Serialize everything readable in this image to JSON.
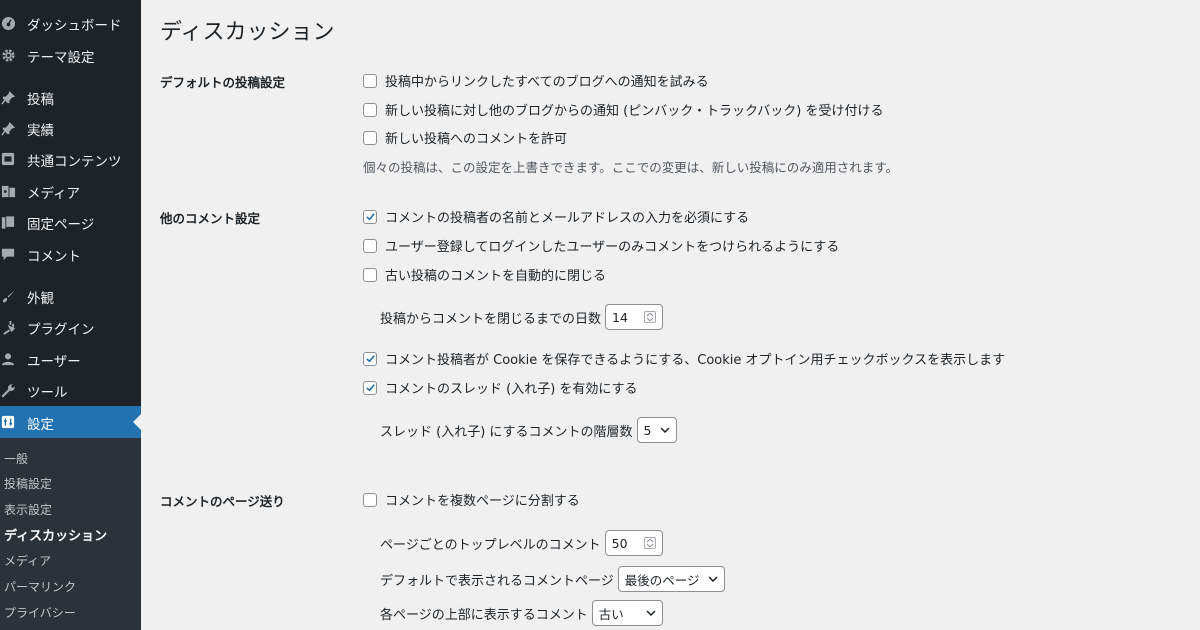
{
  "sidebar": {
    "menu": [
      {
        "label": "ダッシュボード",
        "icon": "dashboard-icon"
      },
      {
        "label": "テーマ設定",
        "icon": "gear-icon"
      },
      {
        "label": "投稿",
        "icon": "pin-icon"
      },
      {
        "label": "実績",
        "icon": "pin-icon"
      },
      {
        "label": "共通コンテンツ",
        "icon": "content-icon"
      },
      {
        "label": "メディア",
        "icon": "media-icon"
      },
      {
        "label": "固定ページ",
        "icon": "page-icon"
      },
      {
        "label": "コメント",
        "icon": "comment-icon"
      },
      {
        "label": "外観",
        "icon": "brush-icon"
      },
      {
        "label": "プラグイン",
        "icon": "plugin-icon"
      },
      {
        "label": "ユーザー",
        "icon": "user-icon"
      },
      {
        "label": "ツール",
        "icon": "wrench-icon"
      },
      {
        "label": "設定",
        "icon": "settings-icon"
      }
    ],
    "submenu": [
      "一般",
      "投稿設定",
      "表示設定",
      "ディスカッション",
      "メディア",
      "パーマリンク",
      "プライバシー"
    ],
    "active_submenu": "ディスカッション"
  },
  "main": {
    "title": "ディスカッション",
    "default_post_settings": {
      "heading": "デフォルトの投稿設定",
      "options": [
        {
          "label": "投稿中からリンクしたすべてのブログへの通知を試みる",
          "checked": false
        },
        {
          "label": "新しい投稿に対し他のブログからの通知 (ピンバック・トラックバック) を受け付ける",
          "checked": false
        },
        {
          "label": "新しい投稿へのコメントを許可",
          "checked": false
        }
      ],
      "description": "個々の投稿は、この設定を上書きできます。ここでの変更は、新しい投稿にのみ適用されます。"
    },
    "other_comment_settings": {
      "heading": "他のコメント設定",
      "options": [
        {
          "label": "コメントの投稿者の名前とメールアドレスの入力を必須にする",
          "checked": true
        },
        {
          "label": "ユーザー登録してログインしたユーザーのみコメントをつけられるようにする",
          "checked": false
        },
        {
          "label": "古い投稿のコメントを自動的に閉じる",
          "checked": false
        }
      ],
      "close_days_label": "投稿からコメントを閉じるまでの日数",
      "close_days_value": "14",
      "options2": [
        {
          "label": "コメント投稿者が Cookie を保存できるようにする、Cookie オプトイン用チェックボックスを表示します",
          "checked": true
        },
        {
          "label": "コメントのスレッド (入れ子) を有効にする",
          "checked": true
        }
      ],
      "thread_depth_label": "スレッド (入れ子) にするコメントの階層数",
      "thread_depth_value": "5"
    },
    "comment_pagination": {
      "heading": "コメントのページ送り",
      "option": {
        "label": "コメントを複数ページに分割する",
        "checked": false
      },
      "per_page_label": "ページごとのトップレベルのコメント",
      "per_page_value": "50",
      "default_page_label": "デフォルトで表示されるコメントページ",
      "default_page_value": "最後のページ",
      "order_label": "各ページの上部に表示するコメント",
      "order_value": "古い"
    }
  },
  "colors": {
    "sidebar_bg": "#1d2327",
    "submenu_bg": "#2c3338",
    "accent": "#2271b1",
    "page_bg": "#f0f0f1",
    "checkmark": "#2271b1"
  }
}
